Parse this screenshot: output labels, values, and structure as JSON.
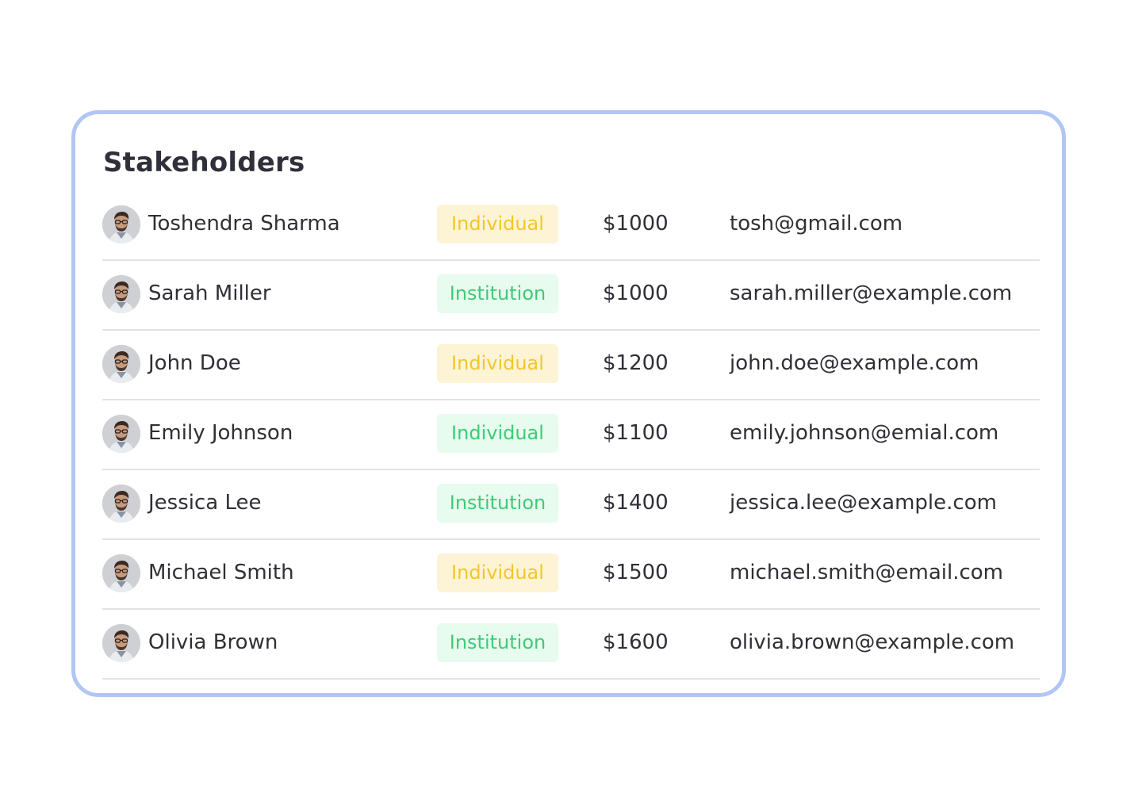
{
  "title": "Stakeholders",
  "colors": {
    "card_border": "#b2c6f4",
    "individual_bg": "#fdf4d6",
    "individual_text": "#f3c62b",
    "institution_bg": "#e7fbee",
    "institution_text": "#3fcb76"
  },
  "rows": [
    {
      "name": "Toshendra Sharma",
      "type": "Individual",
      "badge_color": "yellow",
      "amount": "$1000",
      "email": "tosh@gmail.com",
      "avatar_icon": "person-avatar-icon"
    },
    {
      "name": "Sarah Miller",
      "type": "Institution",
      "badge_color": "green",
      "amount": "$1000",
      "email": "sarah.miller@example.com",
      "avatar_icon": "person-avatar-icon"
    },
    {
      "name": "John Doe",
      "type": "Individual",
      "badge_color": "yellow",
      "amount": "$1200",
      "email": "john.doe@example.com",
      "avatar_icon": "person-avatar-icon"
    },
    {
      "name": "Emily Johnson",
      "type": "Individual",
      "badge_color": "green",
      "amount": "$1100",
      "email": "emily.johnson@emial.com",
      "avatar_icon": "person-avatar-icon"
    },
    {
      "name": "Jessica Lee",
      "type": "Institution",
      "badge_color": "green",
      "amount": "$1400",
      "email": "jessica.lee@example.com",
      "avatar_icon": "person-avatar-icon"
    },
    {
      "name": "Michael Smith",
      "type": "Individual",
      "badge_color": "yellow",
      "amount": "$1500",
      "email": "michael.smith@email.com",
      "avatar_icon": "person-avatar-icon"
    },
    {
      "name": "Olivia Brown",
      "type": "Institution",
      "badge_color": "green",
      "amount": "$1600",
      "email": "olivia.brown@example.com",
      "avatar_icon": "person-avatar-icon"
    }
  ]
}
